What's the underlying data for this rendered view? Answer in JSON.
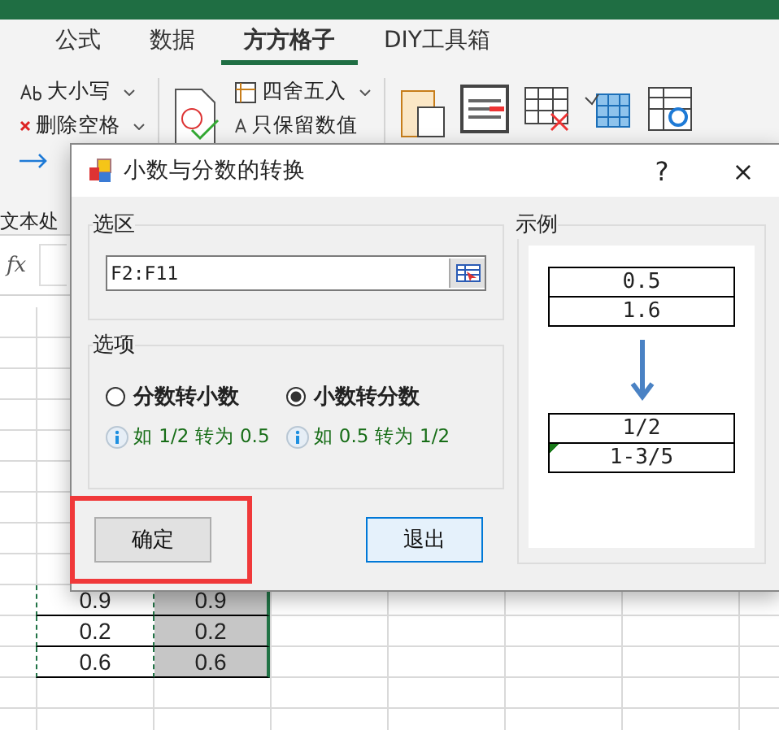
{
  "ribbon": {
    "tabs": [
      {
        "label": "公式",
        "selected": false
      },
      {
        "label": "数据",
        "selected": false
      },
      {
        "label": "方方格子",
        "selected": true
      },
      {
        "label": "DIY工具箱",
        "selected": false
      }
    ],
    "tools": [
      {
        "label": "大小写",
        "kind": "case",
        "dropdown": true
      },
      {
        "label": "删除空格",
        "kind": "trim",
        "dropdown": true
      },
      {
        "label": "四舍五入",
        "kind": "round",
        "dropdown": true
      },
      {
        "label": "只保留数值",
        "kind": "abc",
        "dropdown": false
      }
    ],
    "group_label": "文本处"
  },
  "formula_bar": {
    "fx": "fx"
  },
  "sheet": {
    "rows": [
      [
        "0.9",
        "0.9"
      ],
      [
        "0.2",
        "0.2"
      ],
      [
        "0.6",
        "0.6"
      ]
    ]
  },
  "dialog": {
    "title": "小数与分数的转换",
    "help": "?",
    "close": "×",
    "range": {
      "title": "选区",
      "value": "F2:F11"
    },
    "options": {
      "title": "选项",
      "items": [
        {
          "label": "分数转小数",
          "selected": false,
          "hint": "如 1/2 转为 0.5"
        },
        {
          "label": "小数转分数",
          "selected": true,
          "hint": "如 0.5 转为 1/2"
        }
      ]
    },
    "example": {
      "title": "示例",
      "before": [
        "0.5",
        "1.6"
      ],
      "after": [
        "1/2",
        "1-3/5"
      ]
    },
    "buttons": [
      {
        "label": "确定",
        "default": false,
        "highlighted": true
      },
      {
        "label": "退出",
        "default": true,
        "highlighted": false
      }
    ]
  }
}
